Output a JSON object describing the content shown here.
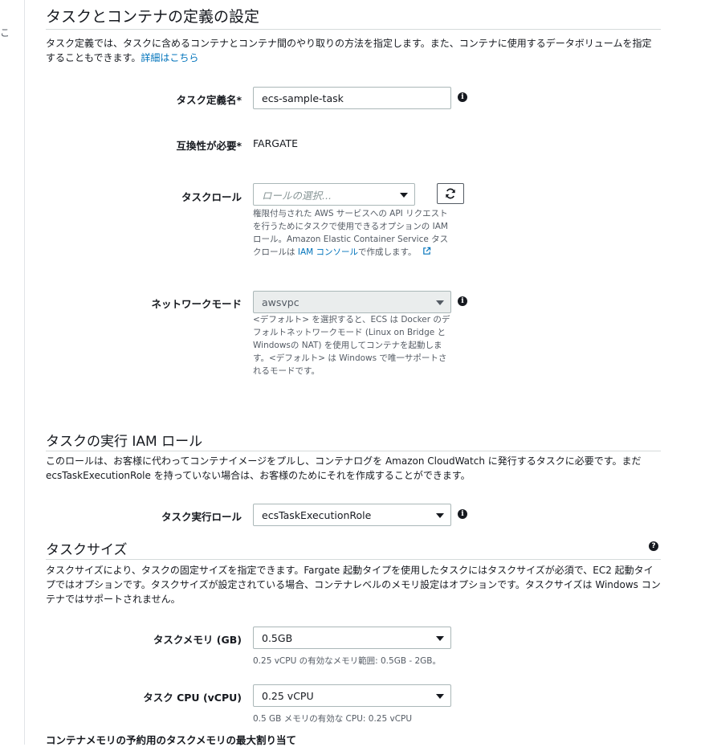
{
  "rail_mark": "こ",
  "task_container": {
    "title": "タスクとコンテナの定義の設定",
    "description": "タスク定義では、タスクに含めるコンテナとコンテナ間のやり取りの方法を指定します。また、コンテナに使用するデータボリュームを指定することもできます。",
    "details_link": "詳細はこちら",
    "task_definition_name": {
      "label": "タスク定義名*",
      "value": "ecs-sample-task"
    },
    "compatibility": {
      "label": "互換性が必要*",
      "value": "FARGATE"
    },
    "task_role": {
      "label": "タスクロール",
      "placeholder": "ロールの選択...",
      "help_before_link": "権限付与された AWS サービスへの API リクエストを行うためにタスクで使用できるオプションの IAM ロール。Amazon Elastic Container Service タスクロールは ",
      "help_link": "IAM コンソール",
      "help_after_link": "で作成します。"
    },
    "network_mode": {
      "label": "ネットワークモード",
      "value": "awsvpc",
      "help": "<デフォルト> を選択すると、ECS は Docker のデフォルトネットワークモード (Linux on Bridge と Windowsの NAT) を使用してコンテナを起動します。<デフォルト> は Windows で唯一サポートされるモードです。"
    }
  },
  "execution_role_section": {
    "title": "タスクの実行 IAM ロール",
    "description": "このロールは、お客様に代わってコンテナイメージをプルし、コンテナログを Amazon CloudWatch に発行するタスクに必要です。まだ ecsTaskExecutionRole を持っていない場合は、お客様のためにそれを作成することができます。",
    "execution_role": {
      "label": "タスク実行ロール",
      "value": "ecsTaskExecutionRole"
    }
  },
  "task_size": {
    "title": "タスクサイズ",
    "description": "タスクサイズにより、タスクの固定サイズを指定できます。Fargate 起動タイプを使用したタスクにはタスクサイズが必須で、EC2 起動タイプではオプションです。タスクサイズが設定されている場合、コンテナレベルのメモリ設定はオプションです。タスクサイズは Windows コンテナではサポートされません。",
    "memory": {
      "label": "タスクメモリ (GB)",
      "value": "0.5GB",
      "help": "0.25 vCPU の有効なメモリ範囲: 0.5GB - 2GB。"
    },
    "cpu": {
      "label": "タスク CPU (vCPU)",
      "value": "0.25 vCPU",
      "help": "0.5 GB メモリの有効な CPU: 0.25 vCPU"
    }
  },
  "container_memory_heading": "コンテナメモリの予約用のタスクメモリの最大割り当て",
  "icons": {
    "info": "info-icon",
    "help": "question-icon",
    "refresh": "refresh-icon",
    "external": "external-link-icon",
    "dropdown": "chevron-down-icon"
  }
}
